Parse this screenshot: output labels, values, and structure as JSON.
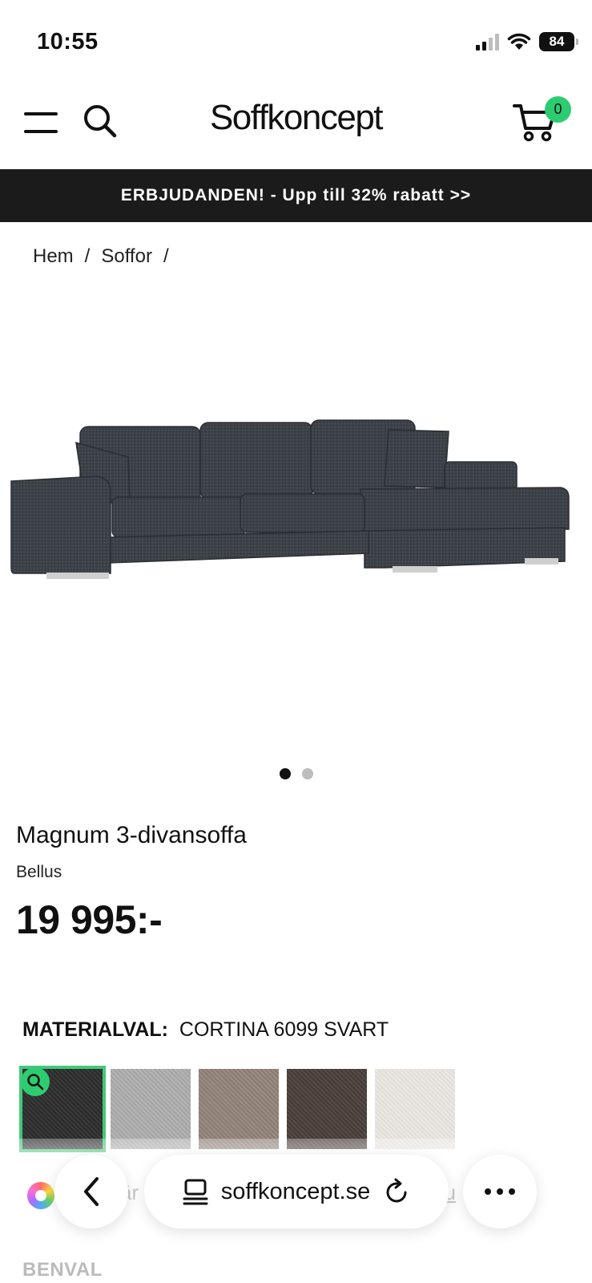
{
  "status_bar": {
    "time": "10:55",
    "battery": "84"
  },
  "header": {
    "brand": "Soffkoncept",
    "cart_count": "0"
  },
  "promo": {
    "text": "ERBJUDANDEN! - Upp till 32% rabatt >>"
  },
  "breadcrumb": {
    "items": [
      "Hem",
      "/",
      "Soffor",
      "/"
    ]
  },
  "gallery": {
    "image_count": 2,
    "active_index": 0
  },
  "product": {
    "title": "Magnum 3-divansoffa",
    "brand": "Bellus",
    "price": "19 995:-"
  },
  "material": {
    "label": "MATERIALVAL:",
    "value": "CORTINA 6099 SVART",
    "swatches": [
      {
        "name": "svart",
        "color": "#2b2b2b",
        "selected": true
      },
      {
        "name": "ljusgra",
        "color": "#a9a9a9",
        "selected": false
      },
      {
        "name": "beige-brun",
        "color": "#8e7f77",
        "selected": false
      },
      {
        "name": "mork-brun",
        "color": "#4a3f3b",
        "selected": false
      },
      {
        "name": "offwhite",
        "color": "#e4e1dc",
        "selected": false
      }
    ]
  },
  "below_fold": {
    "faded_left": "är",
    "faded_right": "ou",
    "benval": "BENVAL"
  },
  "browser": {
    "url": "soffkoncept.se"
  },
  "colors": {
    "accent_green": "#2ecc71",
    "promo_bg": "#1b1b1b"
  }
}
